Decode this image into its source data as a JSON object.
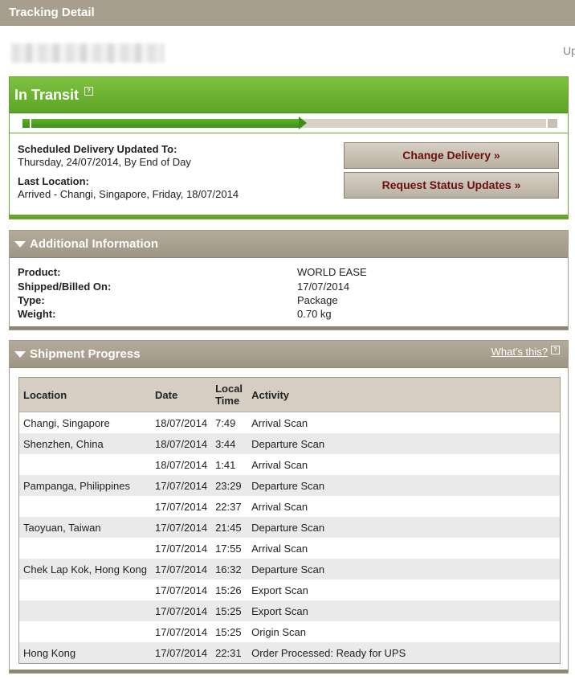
{
  "header": {
    "title": "Tracking Detail"
  },
  "top_right_text": "Up",
  "status": {
    "title": "In Transit",
    "help_icon": "question-icon",
    "progress_fraction": 0.52,
    "scheduled_label": "Scheduled Delivery Updated To:",
    "scheduled_value": "Thursday, 24/07/2014, By End of Day",
    "last_location_label": "Last Location:",
    "last_location_value": "Arrived - Changi, Singapore, Friday, 18/07/2014",
    "change_delivery_button": "Change Delivery »",
    "request_updates_button": "Request Status Updates »"
  },
  "additional": {
    "title": "Additional Information",
    "rows": [
      {
        "label": "Product:",
        "value": "WORLD EASE"
      },
      {
        "label": "Shipped/Billed On:",
        "value": "17/07/2014"
      },
      {
        "label": "Type:",
        "value": "Package"
      },
      {
        "label": "Weight:",
        "value": "0.70 kg"
      }
    ]
  },
  "shipment": {
    "title": "Shipment Progress",
    "whats_this": "What's this?",
    "columns": {
      "location": "Location",
      "date": "Date",
      "local_time_1": "Local",
      "local_time_2": "Time",
      "activity": "Activity"
    },
    "rows": [
      {
        "location": "Changi, Singapore",
        "date": "18/07/2014",
        "time": "7:49",
        "activity": "Arrival Scan"
      },
      {
        "location": "Shenzhen, China",
        "date": "18/07/2014",
        "time": "3:44",
        "activity": "Departure Scan"
      },
      {
        "location": "",
        "date": "18/07/2014",
        "time": "1:41",
        "activity": "Arrival Scan"
      },
      {
        "location": "Pampanga, Philippines",
        "date": "17/07/2014",
        "time": "23:29",
        "activity": "Departure Scan"
      },
      {
        "location": "",
        "date": "17/07/2014",
        "time": "22:37",
        "activity": "Arrival Scan"
      },
      {
        "location": "Taoyuan, Taiwan",
        "date": "17/07/2014",
        "time": "21:45",
        "activity": "Departure Scan"
      },
      {
        "location": "",
        "date": "17/07/2014",
        "time": "17:55",
        "activity": "Arrival Scan"
      },
      {
        "location": "Chek Lap Kok, Hong Kong",
        "date": "17/07/2014",
        "time": "16:32",
        "activity": "Departure Scan"
      },
      {
        "location": "",
        "date": "17/07/2014",
        "time": "15:26",
        "activity": "Export Scan"
      },
      {
        "location": "",
        "date": "17/07/2014",
        "time": "15:25",
        "activity": "Export Scan"
      },
      {
        "location": "",
        "date": "17/07/2014",
        "time": "15:25",
        "activity": "Origin Scan"
      },
      {
        "location": "Hong Kong",
        "date": "17/07/2014",
        "time": "22:31",
        "activity": "Order Processed: Ready for UPS"
      }
    ]
  },
  "colors": {
    "accent_green": "#5ea426",
    "header_tan": "#a79e8e",
    "button_text": "#6b0f0f"
  }
}
